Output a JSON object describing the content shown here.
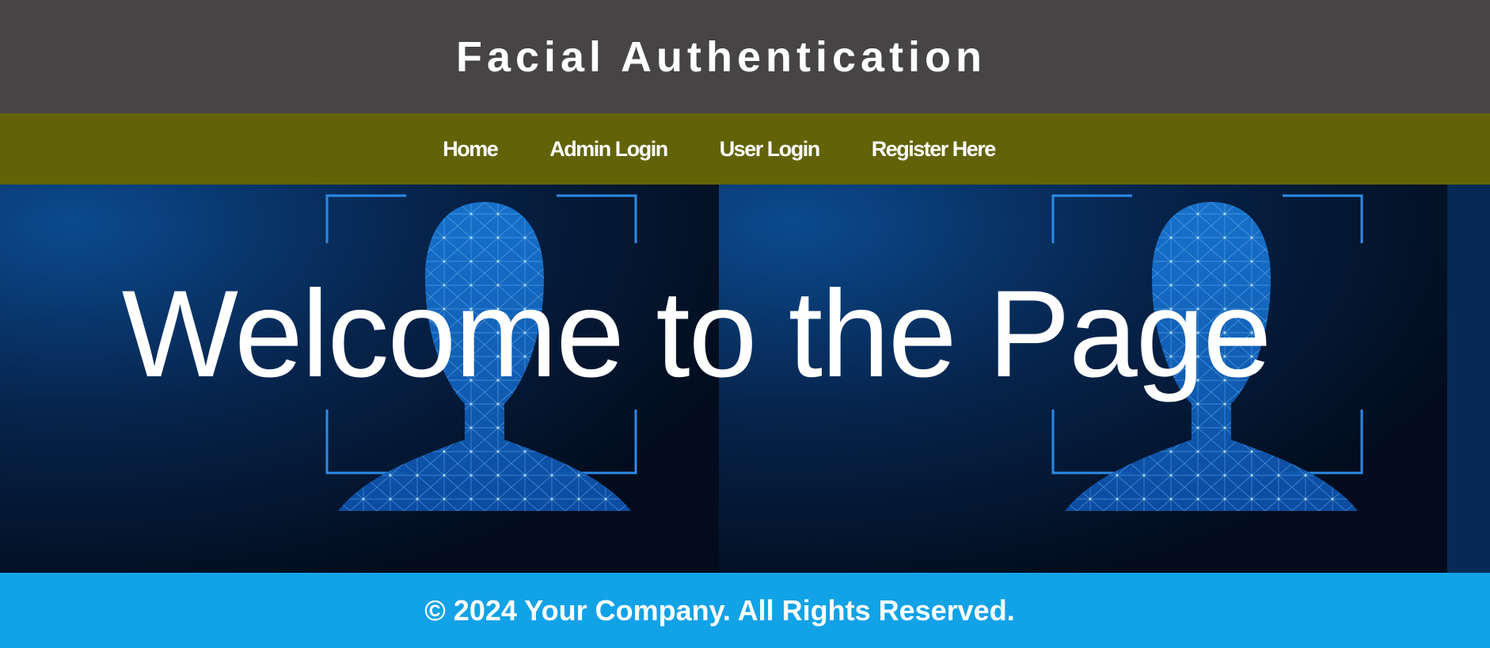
{
  "header": {
    "title": "Facial Authentication"
  },
  "nav": {
    "items": [
      {
        "label": "Home"
      },
      {
        "label": "Admin Login"
      },
      {
        "label": "User Login"
      },
      {
        "label": "Register Here"
      }
    ]
  },
  "hero": {
    "heading": "Welcome to the Page"
  },
  "footer": {
    "text": "© 2024 Your Company. All Rights Reserved."
  },
  "colors": {
    "header_bg": "#464445",
    "nav_bg": "#626307",
    "hero_bg": "#041a35",
    "footer_bg": "#12a2e6",
    "text": "#ffffff"
  }
}
